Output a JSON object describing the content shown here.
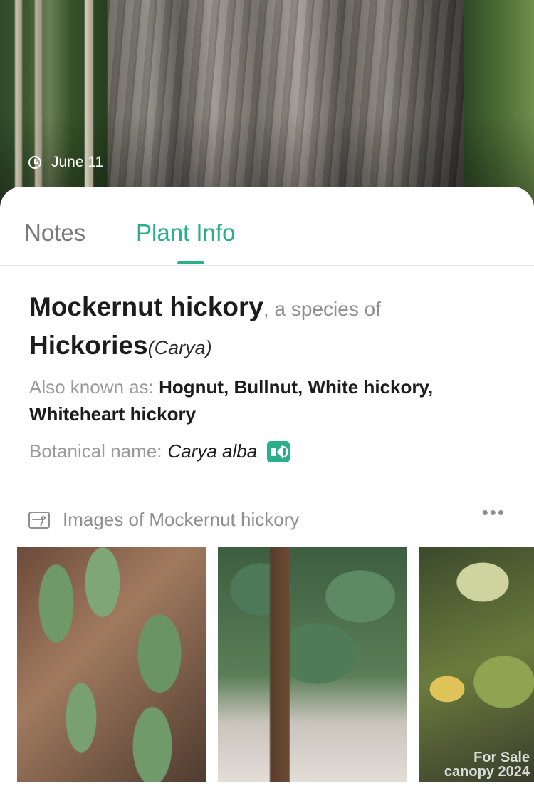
{
  "header": {
    "date": "June 11"
  },
  "tabs": {
    "notes": "Notes",
    "plant_info": "Plant Info"
  },
  "plant": {
    "common_name": "Mockernut hickory",
    "species_connector": ", a species of",
    "genus_common": "Hickories",
    "genus_scientific": "(Carya)",
    "also_known_label": "Also known as: ",
    "also_known_values": "Hognut, Bullnut, White hickory, Whiteheart hickory",
    "botanical_label": "Botanical name:",
    "botanical_value": "Carya alba"
  },
  "images": {
    "title": "Images of Mockernut hickory",
    "more": "•••",
    "watermark_line1": "For Sale",
    "watermark_line2": "canopy 2024"
  },
  "colors": {
    "accent": "#29b08a",
    "muted": "#8f8f8f",
    "text": "#1c1c1c"
  }
}
